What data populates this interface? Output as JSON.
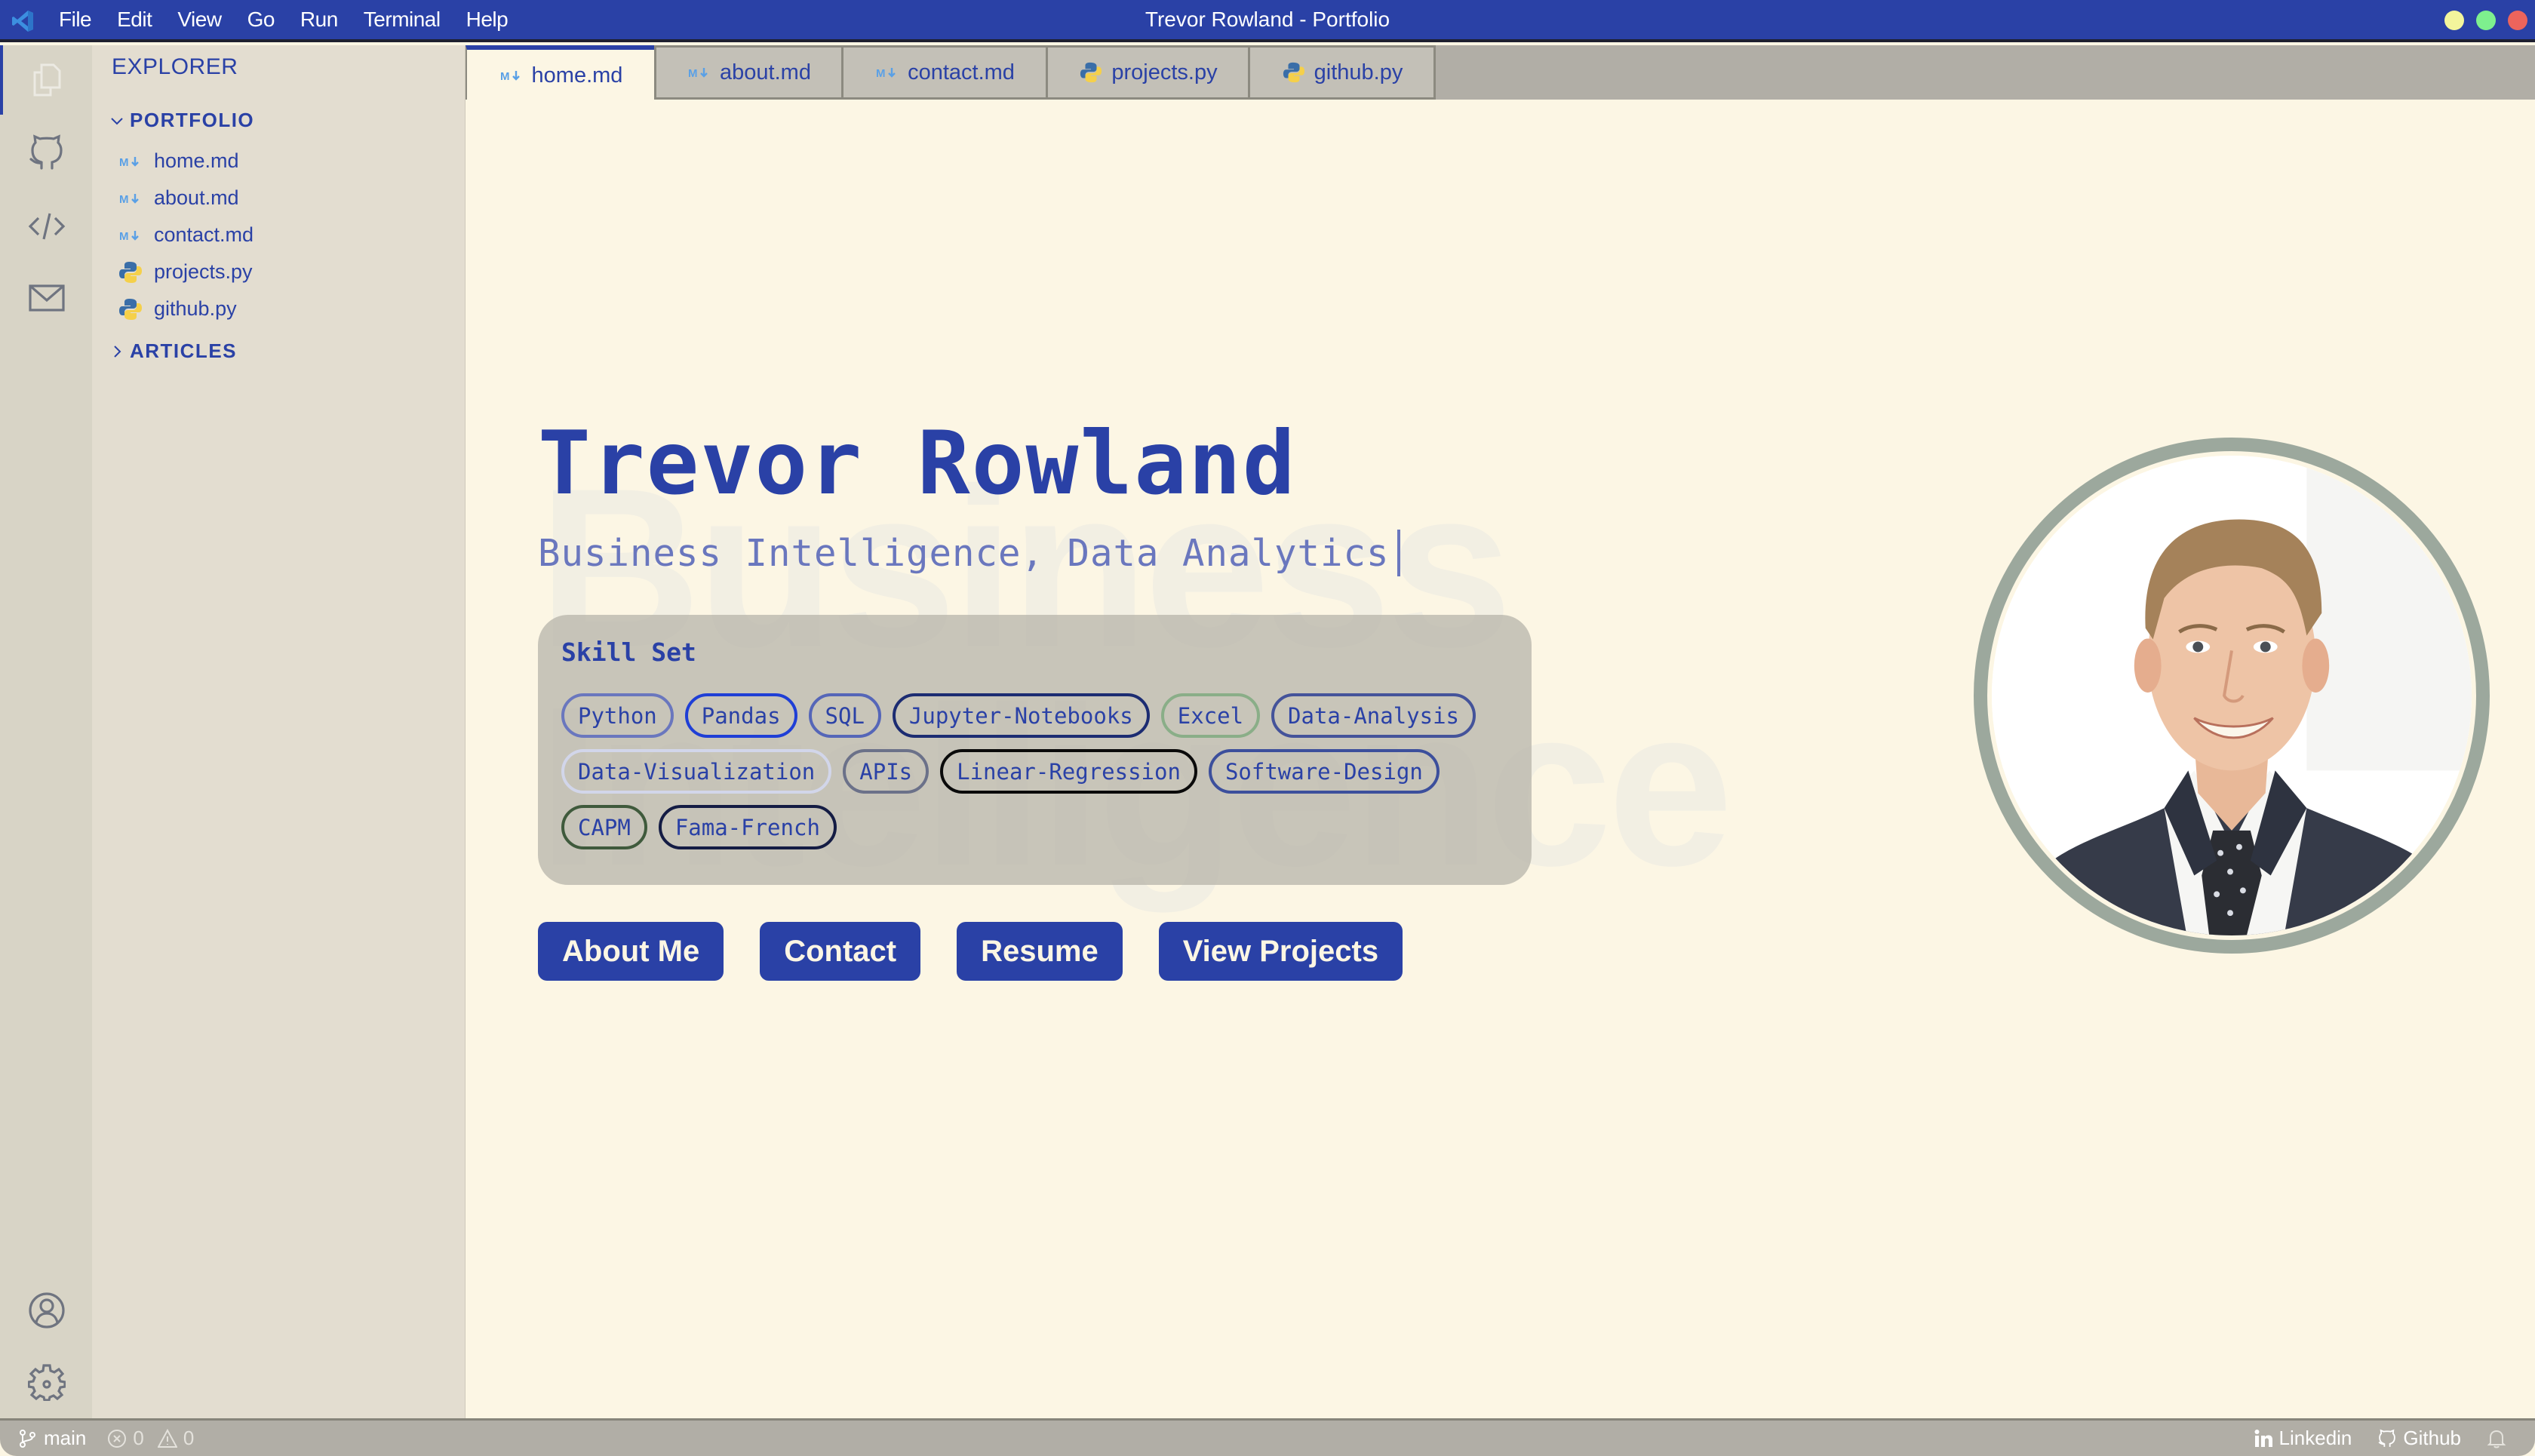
{
  "window": {
    "title": "Trevor Rowland - Portfolio",
    "controls": [
      {
        "name": "minimize",
        "color": "#f3f59c"
      },
      {
        "name": "maximize",
        "color": "#7ef08e"
      },
      {
        "name": "close",
        "color": "#ec645c"
      }
    ]
  },
  "menu": [
    "File",
    "Edit",
    "View",
    "Go",
    "Run",
    "Terminal",
    "Help"
  ],
  "activity_bar": {
    "top": [
      "files-icon",
      "github-icon",
      "code-icon",
      "mail-icon"
    ],
    "bottom": [
      "account-icon",
      "settings-gear-icon"
    ]
  },
  "sidebar": {
    "title": "EXPLORER",
    "folders": [
      {
        "label": "PORTFOLIO",
        "expanded": true,
        "files": [
          {
            "label": "home.md",
            "type": "markdown"
          },
          {
            "label": "about.md",
            "type": "markdown"
          },
          {
            "label": "contact.md",
            "type": "markdown"
          },
          {
            "label": "projects.py",
            "type": "python"
          },
          {
            "label": "github.py",
            "type": "python"
          }
        ]
      },
      {
        "label": "ARTICLES",
        "expanded": false
      }
    ]
  },
  "tabs": [
    {
      "label": "home.md",
      "type": "markdown",
      "active": true
    },
    {
      "label": "about.md",
      "type": "markdown",
      "active": false
    },
    {
      "label": "contact.md",
      "type": "markdown",
      "active": false
    },
    {
      "label": "projects.py",
      "type": "python",
      "active": false
    },
    {
      "label": "github.py",
      "type": "python",
      "active": false
    }
  ],
  "hero": {
    "watermark_line1": "Business",
    "watermark_line2": "Intelligence",
    "name": "Trevor Rowland",
    "subtitle": "Business Intelligence, Data Analytics",
    "skills_title": "Skill Set",
    "skills": [
      {
        "label": "Python",
        "color": "#6a77be"
      },
      {
        "label": "Pandas",
        "color": "#1f3fd6"
      },
      {
        "label": "SQL",
        "color": "#5566b8"
      },
      {
        "label": "Jupyter-Notebooks",
        "color": "#1c2c72"
      },
      {
        "label": "Excel",
        "color": "#8aae88"
      },
      {
        "label": "Data-Analysis",
        "color": "#44539a"
      },
      {
        "label": "Data-Visualization",
        "color": "#d2d6ea"
      },
      {
        "label": "APIs",
        "color": "#6b7189"
      },
      {
        "label": "Linear-Regression",
        "color": "#0a0a0a"
      },
      {
        "label": "Software-Design",
        "color": "#3c4f9c"
      },
      {
        "label": "CAPM",
        "color": "#3f5a3c"
      },
      {
        "label": "Fama-French",
        "color": "#141c44"
      }
    ],
    "buttons": [
      "About Me",
      "Contact",
      "Resume",
      "View Projects"
    ],
    "photo_alt": "Portrait photo of Trevor Rowland"
  },
  "statusbar": {
    "branch": "main",
    "errors": "0",
    "warnings": "0",
    "links": [
      "Linkedin",
      "Github"
    ]
  },
  "colors": {
    "accent": "#2a41a6",
    "editor_bg": "#fcf6e4",
    "sidebar_bg": "#e3ddd0",
    "activity_bg": "#d8d4c6",
    "tabbar_bg": "#b1aea6",
    "photo_ring": "#9ca89d"
  }
}
